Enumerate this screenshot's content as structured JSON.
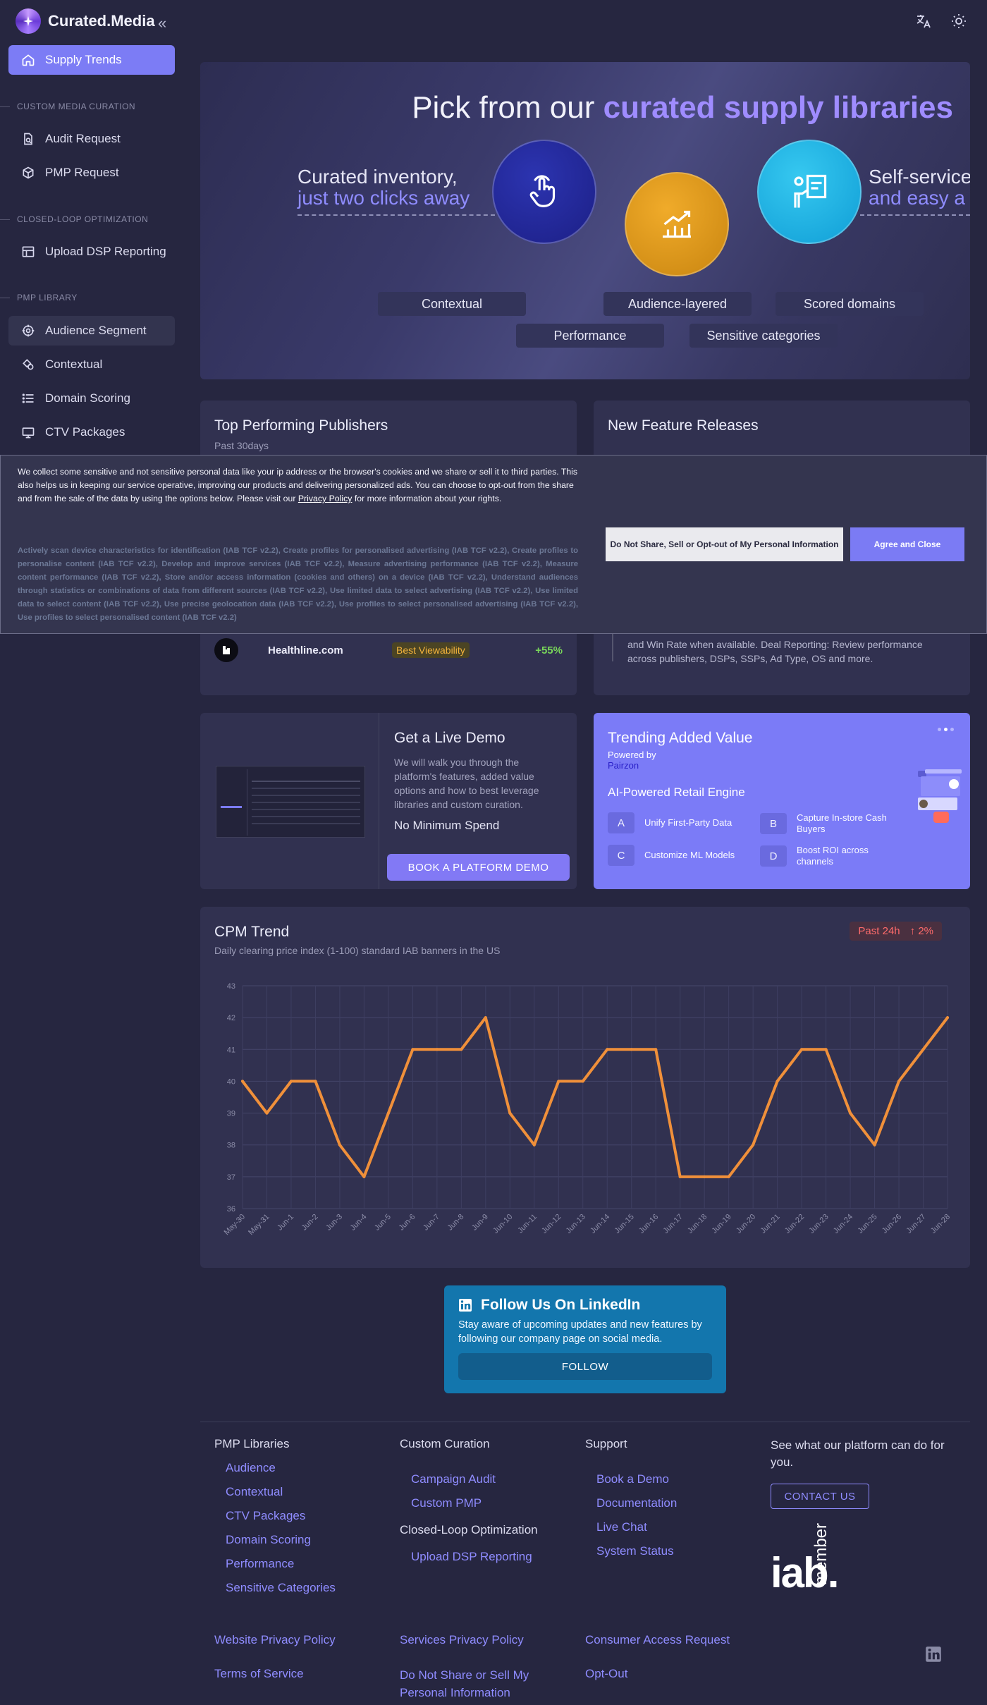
{
  "app": {
    "name": "Curated.Media"
  },
  "sidebar": {
    "active_item": "Supply Trends",
    "sections": {
      "custom": "CUSTOM MEDIA CURATION",
      "closed": "CLOSED-LOOP OPTIMIZATION",
      "pmp": "PMP LIBRARY"
    },
    "items": {
      "audit": "Audit Request",
      "pmp_request": "PMP Request",
      "upload": "Upload DSP Reporting",
      "audience": "Audience Segment",
      "contextual": "Contextual",
      "domain": "Domain Scoring",
      "ctv": "CTV Packages"
    }
  },
  "hero": {
    "title_plain": "Pick from our",
    "title_bold": "curated supply libraries",
    "left_line1": "Curated inventory,",
    "left_line2": "just two clicks away",
    "right_line1": "Self-service",
    "right_line2": "and easy a",
    "tags": [
      "Contextual",
      "Audience-layered",
      "Scored domains",
      "Performance",
      "Sensitive categories"
    ]
  },
  "publishers": {
    "title": "Top Performing Publishers",
    "subtitle": "Past 30days",
    "row": {
      "name": "Healthline.com",
      "badge": "Best Viewability",
      "change": "+55%"
    }
  },
  "features": {
    "title": "New Feature Releases",
    "snippet": "and Win Rate when available. Deal Reporting: Review performance across publishers, DSPs, SSPs, Ad Type, OS and more."
  },
  "cookie": {
    "text_before": "We collect some sensitive and not sensitive personal data like your ip address or the browser's cookies and we share or sell it to third parties. This also helps us in keeping our service operative, improving our products and delivering personalized ads. You can choose to opt-out from the share and from the sale of the data by using the options below. Please visit our",
    "link": "Privacy Policy",
    "text_after": "for more information about your rights.",
    "purposes": "Actively scan device characteristics for identification (IAB TCF v2.2), Create profiles for personalised advertising (IAB TCF v2.2), Create profiles to personalise content (IAB TCF v2.2), Develop and improve services (IAB TCF v2.2), Measure advertising performance (IAB TCF v2.2), Measure content performance (IAB TCF v2.2), Store and/or access information (cookies and others) on a device (IAB TCF v2.2), Understand audiences through statistics or combinations of data from different sources (IAB TCF v2.2), Use limited data to select advertising (IAB TCF v2.2), Use limited data to select content (IAB TCF v2.2), Use precise geolocation data (IAB TCF v2.2), Use profiles to select personalised advertising (IAB TCF v2.2), Use profiles to select personalised content (IAB TCF v2.2)",
    "btn_optout": "Do Not Share, Sell or Opt-out of My Personal Information",
    "btn_agree": "Agree and Close"
  },
  "demo": {
    "title": "Get a Live Demo",
    "text": "We will walk you through the platform's features, added value options and how to best leverage libraries and custom curation.",
    "no_min": "No Minimum Spend",
    "button": "BOOK A PLATFORM DEMO"
  },
  "trending": {
    "title": "Trending Added Value",
    "powered": "Powered by",
    "partner": "Pairzon",
    "engine": "AI-Powered Retail Engine",
    "features": [
      {
        "letter": "A",
        "text": "Unify First-Party Data"
      },
      {
        "letter": "B",
        "text": "Capture In-store Cash Buyers"
      },
      {
        "letter": "C",
        "text": "Customize ML Models"
      },
      {
        "letter": "D",
        "text": "Boost ROI across channels"
      }
    ],
    "carousel_active": 2
  },
  "chart_data": {
    "type": "line",
    "title": "CPM Trend",
    "subtitle": "Daily clearing price index (1-100) standard IAB banners in the US",
    "range_label": "Past 24h",
    "change": "2%",
    "x": [
      "May-30",
      "May-31",
      "Jun-1",
      "Jun-2",
      "Jun-3",
      "Jun-4",
      "Jun-5",
      "Jun-6",
      "Jun-7",
      "Jun-8",
      "Jun-9",
      "Jun-10",
      "Jun-11",
      "Jun-12",
      "Jun-13",
      "Jun-14",
      "Jun-15",
      "Jun-16",
      "Jun-17",
      "Jun-18",
      "Jun-19",
      "Jun-20",
      "Jun-21",
      "Jun-22",
      "Jun-23",
      "Jun-24",
      "Jun-25",
      "Jun-26",
      "Jun-27",
      "Jun-28"
    ],
    "values": [
      40,
      39,
      40,
      40,
      38,
      37,
      39,
      41,
      41,
      41,
      42,
      39,
      38,
      40,
      40,
      41,
      41,
      41,
      37,
      37,
      37,
      38,
      40,
      41,
      41,
      39,
      38,
      40,
      41,
      42
    ],
    "ylim": [
      36,
      43
    ],
    "yticks": [
      36,
      37,
      38,
      39,
      40,
      41,
      42,
      43
    ],
    "grid": true,
    "line_color": "#f0903a"
  },
  "linkedin": {
    "title": "Follow Us On LinkedIn",
    "text": "Stay aware of upcoming updates and new features by following our company page on social media.",
    "button": "FOLLOW"
  },
  "footer": {
    "col1": {
      "heading": "PMP Libraries",
      "links": [
        "Audience",
        "Contextual",
        "CTV Packages",
        "Domain Scoring",
        "Performance",
        "Sensitive Categories"
      ]
    },
    "col2": {
      "heading": "Custom Curation",
      "links": [
        "Campaign Audit",
        "Custom PMP"
      ],
      "heading2": "Closed-Loop Optimization",
      "links2": [
        "Upload DSP Reporting"
      ]
    },
    "col3": {
      "heading": "Support",
      "links": [
        "Book a Demo",
        "Documentation",
        "Live Chat",
        "System Status"
      ]
    },
    "col4": {
      "text": "See what our platform can do for you.",
      "button": "CONTACT US",
      "iab_main": "iab.",
      "iab_sub": "member"
    },
    "legal": [
      "Website Privacy Policy",
      "Services Privacy Policy",
      "Consumer Access Request",
      "Terms of Service",
      "Do Not Share or Sell My Personal Information",
      "Opt-Out"
    ]
  }
}
